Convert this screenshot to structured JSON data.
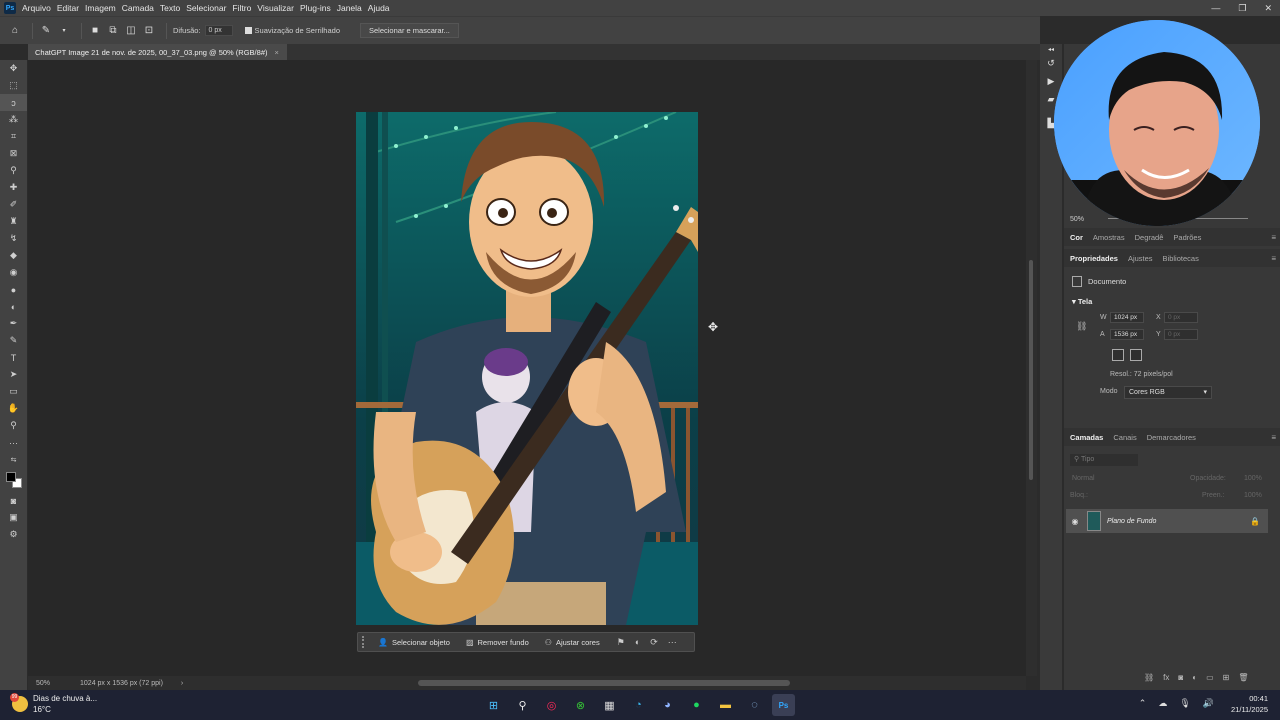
{
  "app": {
    "logo": "Ps"
  },
  "menu": [
    "Arquivo",
    "Editar",
    "Imagem",
    "Camada",
    "Texto",
    "Selecionar",
    "Filtro",
    "Visualizar",
    "Plug-ins",
    "Janela",
    "Ajuda"
  ],
  "options": {
    "feather_label": "Difusão:",
    "feather_value": "0 px",
    "antialias_label": "Suavização de Serrilhado",
    "select_mask_label": "Selecionar e mascarar..."
  },
  "document_tab": {
    "title": "ChatGPT Image 21 de nov. de 2025, 00_37_03.png @ 50% (RGB/8#)",
    "close": "×"
  },
  "context_bar": {
    "select_object": "Selecionar objeto",
    "remove_bg": "Remover fundo",
    "adjust_colors": "Ajustar cores"
  },
  "status": {
    "zoom": "50%",
    "doc_info": "1024 px x 1536 px (72 ppi)"
  },
  "navigator": {
    "zoom": "50%"
  },
  "color_tabs": [
    "Cor",
    "Amostras",
    "Degradê",
    "Padrões"
  ],
  "properties_tabs": [
    "Propriedades",
    "Ajustes",
    "Bibliotecas"
  ],
  "properties": {
    "doc_label": "Documento",
    "section": "Tela",
    "w_label": "W",
    "w_value": "1024 px",
    "h_label": "A",
    "h_value": "1536 px",
    "x_label": "X",
    "x_value": "0 px",
    "y_label": "Y",
    "y_value": "0 px",
    "resolution": "Resol.: 72 pixels/pol",
    "mode_label": "Modo",
    "mode_value": "Cores RGB"
  },
  "layers_tabs": [
    "Camadas",
    "Canais",
    "Demarcadores"
  ],
  "layers": {
    "search_placeholder": "Tipo",
    "blend_mode": "Normal",
    "opacity_label": "Opacidade:",
    "opacity_value": "100%",
    "lock_label": "Bloq.:",
    "fill_label": "Preen.:",
    "fill_value": "100%",
    "items": [
      {
        "name": "Plano de Fundo"
      }
    ]
  },
  "taskbar": {
    "weather_title": "Dias de chuva à...",
    "weather_temp": "16°C",
    "weather_badge": "99",
    "time": "00:41",
    "date": "21/11/2025"
  },
  "colors": {
    "accent": "#31a8ff",
    "panel": "#383838",
    "canvas": "#282828"
  }
}
